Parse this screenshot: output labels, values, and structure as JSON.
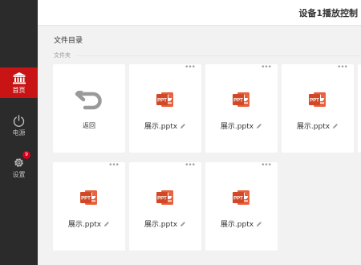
{
  "sidebar": {
    "items": [
      {
        "label": "首页",
        "icon": "bank-icon",
        "active": true
      },
      {
        "label": "电源",
        "icon": "power-icon",
        "active": false
      },
      {
        "label": "设置",
        "icon": "gear-icon",
        "active": false,
        "badge": "9"
      }
    ]
  },
  "header": {
    "title": "设备1播放控制"
  },
  "main": {
    "title": "文件目录",
    "section_label": "文件夹",
    "back_label": "返回",
    "more_label": "•••",
    "files": [
      {
        "name": "展示.pptx",
        "icon_text": "PPT",
        "type": "pptx"
      },
      {
        "name": "展示.pptx",
        "icon_text": "PPT",
        "type": "pptx"
      },
      {
        "name": "展示.pptx",
        "icon_text": "PPT",
        "type": "pptx"
      },
      {
        "name": "展示.pptx",
        "icon_text": "PPT",
        "type": "pptx"
      },
      {
        "name": "展示.pptx",
        "icon_text": "PPT",
        "type": "pptx"
      },
      {
        "name": "展示.pptx",
        "icon_text": "PPT",
        "type": "pptx"
      }
    ]
  },
  "colors": {
    "accent": "#c81414",
    "sidebar_bg": "#2b2b2b",
    "ppt_red": "#d24726",
    "page_bg": "#f2f2f2"
  }
}
